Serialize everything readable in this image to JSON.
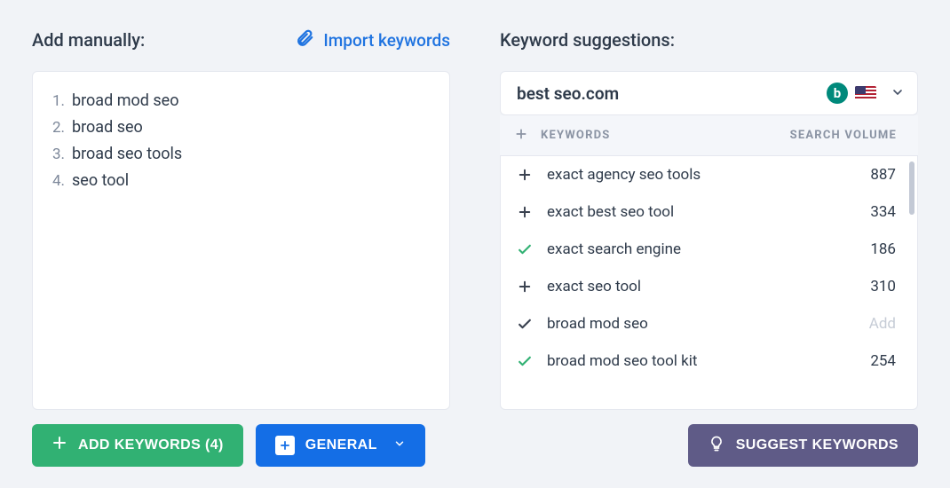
{
  "left": {
    "title": "Add manually:",
    "import_label": "Import keywords",
    "items": [
      "broad mod seo",
      "broad seo",
      "broad seo tools",
      "seo tool"
    ],
    "add_button": "ADD KEYWORDS (4)",
    "group_button": "GENERAL"
  },
  "right": {
    "title": "Keyword suggestions:",
    "domain_value": "best seo.com",
    "search_engine": "bing",
    "country": "US",
    "col_keywords": "KEYWORDS",
    "col_volume": "SEARCH VOLUME",
    "rows": [
      {
        "state": "add",
        "label": "exact agency seo tools",
        "volume": "887"
      },
      {
        "state": "add",
        "label": "exact best seo tool",
        "volume": "334"
      },
      {
        "state": "added",
        "label": "exact search engine",
        "volume": "186"
      },
      {
        "state": "add",
        "label": "exact seo tool",
        "volume": "310"
      },
      {
        "state": "added-dark",
        "label": "broad mod seo",
        "volume": "Add",
        "placeholder": true
      },
      {
        "state": "added",
        "label": "broad mod seo tool kit",
        "volume": "254"
      }
    ],
    "suggest_button": "SUGGEST KEYWORDS"
  }
}
